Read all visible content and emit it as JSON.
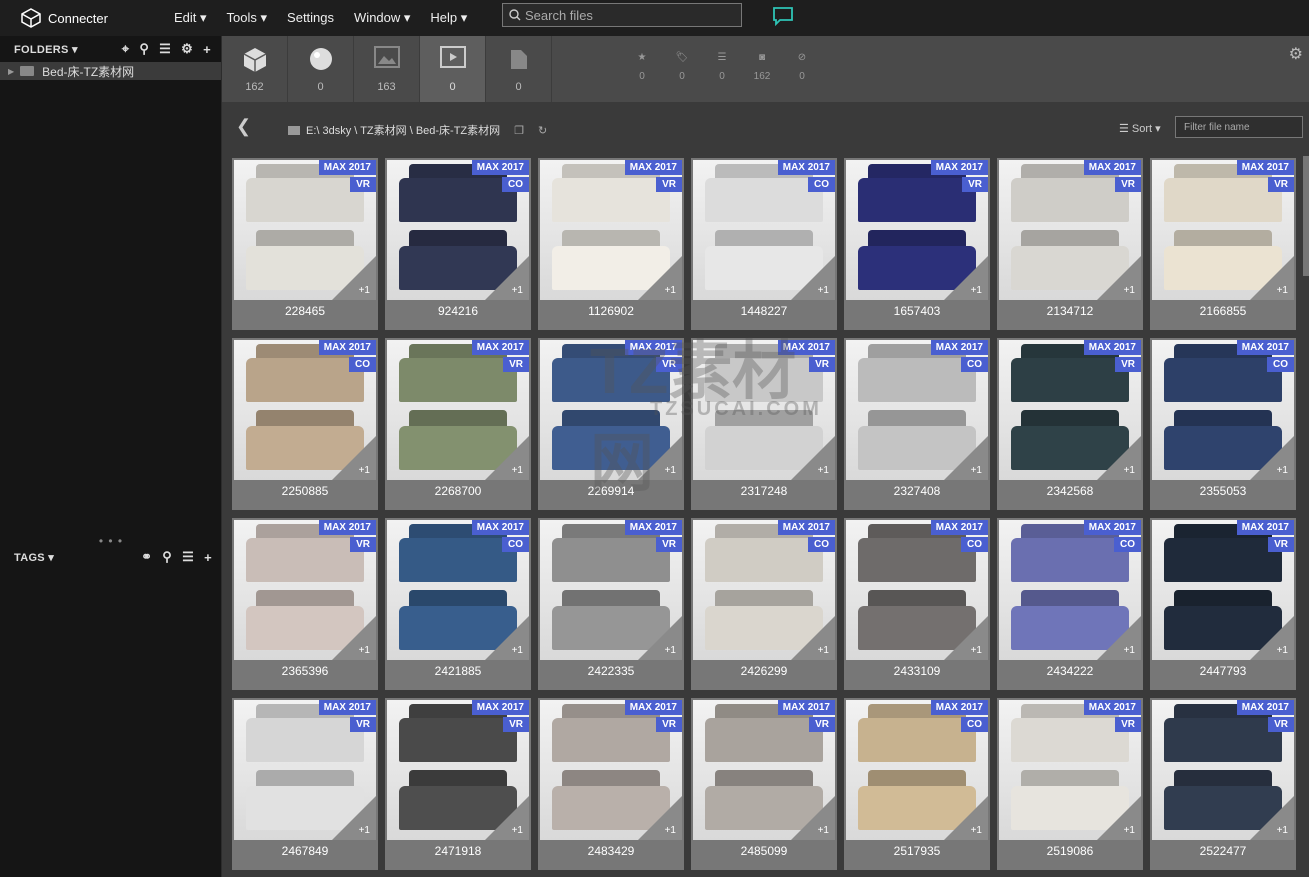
{
  "app": {
    "title": "Connecter"
  },
  "menu": [
    "Edit ▾",
    "Tools ▾",
    "Settings",
    "Window ▾",
    "Help ▾"
  ],
  "search": {
    "placeholder": "Search files"
  },
  "sidebar": {
    "folders_label": "FOLDERS ▾",
    "folder_items": [
      "Bed-床-TZ素材网"
    ],
    "tags_label": "TAGS ▾"
  },
  "tabs": [
    {
      "icon": "cube-icon",
      "count": "162"
    },
    {
      "icon": "sphere-icon",
      "count": "0"
    },
    {
      "icon": "image-icon",
      "count": "163"
    },
    {
      "icon": "film-icon",
      "count": "0"
    },
    {
      "icon": "document-icon",
      "count": "0"
    }
  ],
  "filters": [
    {
      "icon": "star-icon",
      "count": "0"
    },
    {
      "icon": "tag-icon",
      "count": "0"
    },
    {
      "icon": "list-icon",
      "count": "0"
    },
    {
      "icon": "camera-icon",
      "count": "162"
    },
    {
      "icon": "block-icon",
      "count": "0"
    }
  ],
  "path": {
    "text": "E:\\ 3dsky \\ TZ素材网 \\ Bed-床-TZ素材网"
  },
  "sort": {
    "label": "Sort ▾"
  },
  "filter": {
    "placeholder": "Filter file name"
  },
  "watermark": {
    "line1": "TZ素材网",
    "line2": "TZSUCAI.COM"
  },
  "items": [
    {
      "id": "228465",
      "renderer": "VR",
      "extra": "+1"
    },
    {
      "id": "924216",
      "renderer": "CO",
      "extra": "+1"
    },
    {
      "id": "1126902",
      "renderer": "VR",
      "extra": "+1"
    },
    {
      "id": "1448227",
      "renderer": "CO",
      "extra": "+1"
    },
    {
      "id": "1657403",
      "renderer": "VR",
      "extra": "+1"
    },
    {
      "id": "2134712",
      "renderer": "VR",
      "extra": "+1"
    },
    {
      "id": "2166855",
      "renderer": "VR",
      "extra": "+1"
    },
    {
      "id": "2250885",
      "renderer": "CO",
      "extra": "+1"
    },
    {
      "id": "2268700",
      "renderer": "VR",
      "extra": "+1"
    },
    {
      "id": "2269914",
      "renderer": "VR",
      "extra": "+1"
    },
    {
      "id": "2317248",
      "renderer": "VR",
      "extra": "+1"
    },
    {
      "id": "2327408",
      "renderer": "CO",
      "extra": "+1"
    },
    {
      "id": "2342568",
      "renderer": "VR",
      "extra": "+1"
    },
    {
      "id": "2355053",
      "renderer": "CO",
      "extra": "+1"
    },
    {
      "id": "2365396",
      "renderer": "VR",
      "extra": "+1"
    },
    {
      "id": "2421885",
      "renderer": "CO",
      "extra": "+1"
    },
    {
      "id": "2422335",
      "renderer": "VR",
      "extra": "+1"
    },
    {
      "id": "2426299",
      "renderer": "CO",
      "extra": "+1"
    },
    {
      "id": "2433109",
      "renderer": "CO",
      "extra": "+1"
    },
    {
      "id": "2434222",
      "renderer": "CO",
      "extra": "+1"
    },
    {
      "id": "2447793",
      "renderer": "VR",
      "extra": "+1"
    },
    {
      "id": "2467849",
      "renderer": "VR",
      "extra": "+1"
    },
    {
      "id": "2471918",
      "renderer": "VR",
      "extra": "+1"
    },
    {
      "id": "2483429",
      "renderer": "VR",
      "extra": "+1"
    },
    {
      "id": "2485099",
      "renderer": "VR",
      "extra": "+1"
    },
    {
      "id": "2517935",
      "renderer": "CO",
      "extra": "+1"
    },
    {
      "id": "2519086",
      "renderer": "VR",
      "extra": "+1"
    },
    {
      "id": "2522477",
      "renderer": "VR",
      "extra": "+1"
    }
  ],
  "badge": {
    "max": "MAX 2017",
    "color": "#4a5fd0"
  },
  "bed_colors": [
    "#d8d6d0",
    "#2f3550",
    "#e6e3dc",
    "#dcdcdc",
    "#2a2e74",
    "#cfcdc8",
    "#e0d8c8",
    "#b9a48a",
    "#7d8a6a",
    "#3d5a8a",
    "#c8c8c8",
    "#bbbbbb",
    "#2d3f45",
    "#2d4068",
    "#c9bdb7",
    "#355a86",
    "#8f8f8f",
    "#d0ccc4",
    "#6e6b6a",
    "#6a6fb0",
    "#1f2a3a",
    "#d6d6d6",
    "#4a4a4a",
    "#b0a8a2",
    "#a9a39d",
    "#c7b28f",
    "#dcd9d3",
    "#2f3a4c"
  ]
}
